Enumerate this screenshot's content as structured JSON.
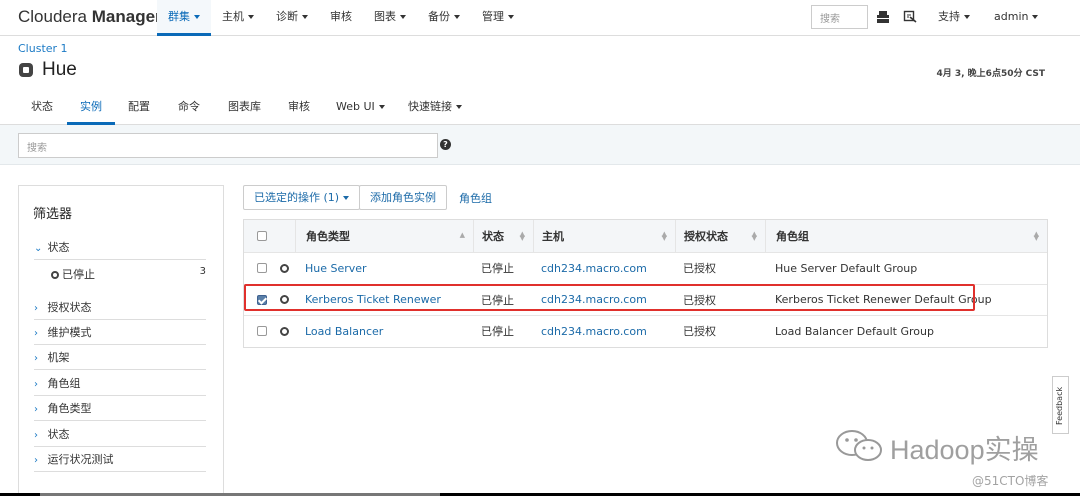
{
  "brand": {
    "prefix": "Cloudera",
    "name": "Manager"
  },
  "nav": [
    {
      "label": "群集",
      "caret": true,
      "active": true
    },
    {
      "label": "主机",
      "caret": true
    },
    {
      "label": "诊断",
      "caret": true
    },
    {
      "label": "审核",
      "caret": false
    },
    {
      "label": "图表",
      "caret": true
    },
    {
      "label": "备份",
      "caret": true
    },
    {
      "label": "管理",
      "caret": true
    }
  ],
  "top_search_placeholder": "搜索",
  "top_support": "支持",
  "top_user": "admin",
  "cluster": "Cluster 1",
  "service_title": "Hue",
  "timestamp": "4月 3, 晚上6点50分 CST",
  "subtabs": [
    "状态",
    "实例",
    "配置",
    "命令",
    "图表库",
    "审核",
    "Web UI",
    "快速链接"
  ],
  "main_search_placeholder": "搜索",
  "help_glyph": "?",
  "filters": {
    "title": "筛选器",
    "status_open": "状态",
    "stopped": "已停止",
    "stopped_count": "3",
    "sections": [
      "授权状态",
      "维护模式",
      "机架",
      "角色组",
      "角色类型",
      "状态",
      "运行状况测试"
    ]
  },
  "actions": {
    "selected_ops": "已选定的操作 (1)",
    "add_role": "添加角色实例",
    "role_group": "角色组"
  },
  "table": {
    "headers": [
      "角色类型",
      "状态",
      "主机",
      "授权状态",
      "角色组"
    ],
    "rows": [
      {
        "checked": false,
        "role": "Hue Server",
        "status": "已停止",
        "host": "cdh234.macro.com",
        "auth": "已授权",
        "group": "Hue Server Default Group"
      },
      {
        "checked": true,
        "role": "Kerberos Ticket Renewer",
        "status": "已停止",
        "host": "cdh234.macro.com",
        "auth": "已授权",
        "group": "Kerberos Ticket Renewer Default Group"
      },
      {
        "checked": false,
        "role": "Load Balancer",
        "status": "已停止",
        "host": "cdh234.macro.com",
        "auth": "已授权",
        "group": "Load Balancer Default Group"
      }
    ]
  },
  "feedback": "Feedback",
  "watermark": {
    "main": "Hadoop实操",
    "sub": "@51CTO博客"
  },
  "colors": {
    "accent": "#0a6ab8",
    "highlight": "#e0302c"
  }
}
